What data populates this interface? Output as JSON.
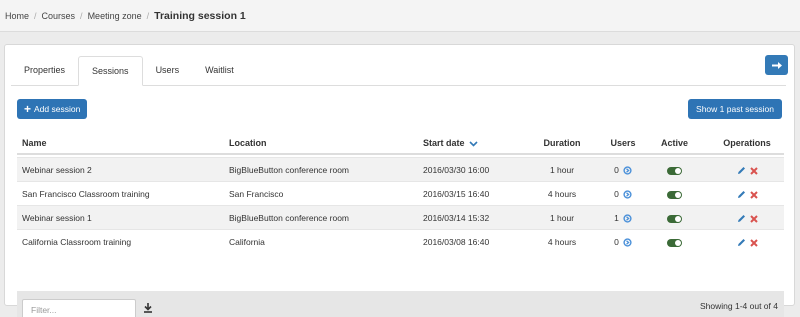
{
  "breadcrumb": {
    "items": [
      "Home",
      "Courses",
      "Meeting zone"
    ],
    "current": "Training session 1"
  },
  "tabs": [
    {
      "label": "Properties",
      "active": false
    },
    {
      "label": "Sessions",
      "active": true
    },
    {
      "label": "Users",
      "active": false
    },
    {
      "label": "Waitlist",
      "active": false
    }
  ],
  "toolbar": {
    "add_label": "Add session",
    "past_label": "Show 1 past session",
    "export_icon": "arrow-right-icon"
  },
  "table": {
    "headers": {
      "name": "Name",
      "location": "Location",
      "start_date": "Start date",
      "duration": "Duration",
      "users": "Users",
      "active": "Active",
      "operations": "Operations"
    },
    "rows": [
      {
        "name": "Webinar session 2",
        "location": "BigBlueButton conference room",
        "start_date": "2016/03/30 16:00",
        "duration": "1 hour",
        "users": "0",
        "active": true
      },
      {
        "name": "San Francisco Classroom training",
        "location": "San Francisco",
        "start_date": "2016/03/15 16:40",
        "duration": "4 hours",
        "users": "0",
        "active": true
      },
      {
        "name": "Webinar session 1",
        "location": "BigBlueButton conference room",
        "start_date": "2016/03/14 15:32",
        "duration": "1 hour",
        "users": "1",
        "active": true
      },
      {
        "name": "California Classroom training",
        "location": "California",
        "start_date": "2016/03/08 16:40",
        "duration": "4 hours",
        "users": "0",
        "active": true
      }
    ]
  },
  "footer": {
    "filter_placeholder": "Filter...",
    "showing": "Showing 1-4 out of 4"
  },
  "colors": {
    "primary": "#2e74b5",
    "active_toggle": "#3b6a37",
    "edit_icon": "#337ab7",
    "delete_icon": "#d9534f"
  }
}
